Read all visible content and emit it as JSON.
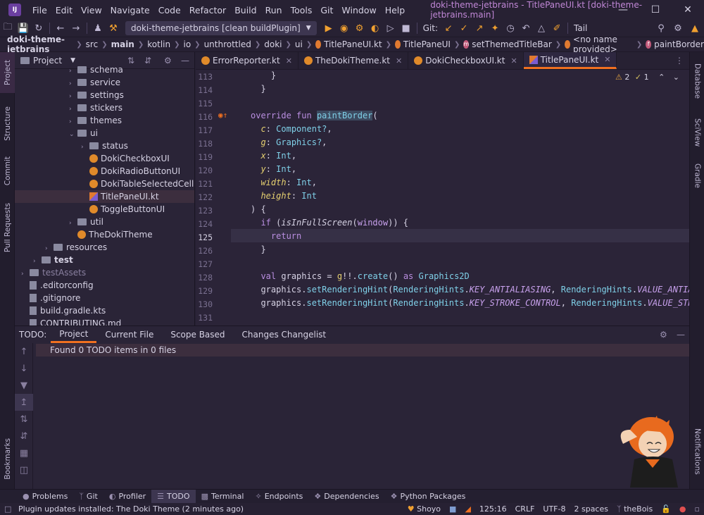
{
  "app": {
    "logo_text": "IJ",
    "window_title": "doki-theme-jetbrains - TitlePaneUI.kt [doki-theme-jetbrains.main]"
  },
  "menu": [
    "File",
    "Edit",
    "View",
    "Navigate",
    "Code",
    "Refactor",
    "Build",
    "Run",
    "Tools",
    "Git",
    "Window",
    "Help"
  ],
  "toolbar": {
    "run_config": "doki-theme-jetbrains [clean buildPlugin]",
    "git_label": "Git:",
    "tail_label": "Tail"
  },
  "breadcrumb": [
    "doki-theme-jetbrains",
    "src",
    "main",
    "kotlin",
    "io",
    "unthrottled",
    "doki",
    "ui",
    "TitlePaneUI.kt",
    "TitlePaneUI",
    "setThemedTitleBar",
    "<no name provided>",
    "paintBorder"
  ],
  "left_stripe": [
    "Project",
    "Structure",
    "Commit",
    "Pull Requests",
    "Bookmarks"
  ],
  "right_stripe": [
    "Database",
    "SciView",
    "Gradle",
    "Notifications"
  ],
  "project_panel": {
    "title": "Project",
    "tree": [
      {
        "label": "schema",
        "kind": "folder",
        "depth": 5,
        "arrow": "›"
      },
      {
        "label": "service",
        "kind": "folder",
        "depth": 5,
        "arrow": "›"
      },
      {
        "label": "settings",
        "kind": "folder",
        "depth": 5,
        "arrow": "›"
      },
      {
        "label": "stickers",
        "kind": "folder",
        "depth": 5,
        "arrow": "›"
      },
      {
        "label": "themes",
        "kind": "folder",
        "depth": 5,
        "arrow": "›"
      },
      {
        "label": "ui",
        "kind": "folder",
        "depth": 5,
        "arrow": "⌄"
      },
      {
        "label": "status",
        "kind": "folder",
        "depth": 6,
        "arrow": "›"
      },
      {
        "label": "DokiCheckboxUI",
        "kind": "kt",
        "depth": 6,
        "arrow": ""
      },
      {
        "label": "DokiRadioButtonUI",
        "kind": "kt",
        "depth": 6,
        "arrow": ""
      },
      {
        "label": "DokiTableSelectedCellHig",
        "kind": "kt",
        "depth": 6,
        "arrow": ""
      },
      {
        "label": "TitlePaneUI.kt",
        "kind": "ktfile",
        "depth": 6,
        "arrow": "",
        "selected": true
      },
      {
        "label": "ToggleButtonUI",
        "kind": "kt",
        "depth": 6,
        "arrow": ""
      },
      {
        "label": "util",
        "kind": "folder",
        "depth": 5,
        "arrow": "›"
      },
      {
        "label": "TheDokiTheme",
        "kind": "kt",
        "depth": 5,
        "arrow": ""
      },
      {
        "label": "resources",
        "kind": "folder",
        "depth": 3,
        "arrow": "›"
      },
      {
        "label": "test",
        "kind": "folder",
        "depth": 2,
        "arrow": "›",
        "bold": true
      },
      {
        "label": "testAssets",
        "kind": "folder",
        "depth": 1,
        "arrow": "›",
        "dim": true
      },
      {
        "label": ".editorconfig",
        "kind": "file",
        "depth": 1,
        "arrow": ""
      },
      {
        "label": ".gitignore",
        "kind": "file",
        "depth": 1,
        "arrow": ""
      },
      {
        "label": "build.gradle.kts",
        "kind": "file",
        "depth": 1,
        "arrow": ""
      },
      {
        "label": "CONTRIBUTING.md",
        "kind": "file",
        "depth": 1,
        "arrow": ""
      }
    ]
  },
  "editor_tabs": [
    {
      "label": "ErrorReporter.kt",
      "active": false
    },
    {
      "label": "TheDokiTheme.kt",
      "active": false
    },
    {
      "label": "DokiCheckboxUI.kt",
      "active": false
    },
    {
      "label": "TitlePaneUI.kt",
      "active": true
    }
  ],
  "inspection": {
    "warnings": "2",
    "ok": "1"
  },
  "code": {
    "line_numbers": [
      "113",
      "114",
      "115",
      "116",
      "117",
      "118",
      "119",
      "120",
      "121",
      "122",
      "123",
      "124",
      "125",
      "126",
      "127",
      "128",
      "129",
      "130",
      "131"
    ],
    "current_line": "125"
  },
  "todo_panel": {
    "label": "TODO:",
    "tabs": [
      "Project",
      "Current File",
      "Scope Based",
      "Changes Changelist"
    ],
    "result": "Found 0 TODO items in 0 files"
  },
  "bottom_tools": [
    "Problems",
    "Git",
    "Profiler",
    "TODO",
    "Terminal",
    "Endpoints",
    "Dependencies",
    "Python Packages"
  ],
  "status": {
    "message": "Plugin updates installed: The Doki Theme (2 minutes ago)",
    "theme": "Shoyo",
    "position": "125:16",
    "line_sep": "CRLF",
    "encoding": "UTF-8",
    "indent": "2 spaces",
    "branch": "theBois"
  },
  "colors": {
    "accent": "#f07020",
    "background": "#2b2438",
    "keyword": "#b98ee0",
    "function": "#7fd0e8",
    "param": "#e6d070"
  }
}
